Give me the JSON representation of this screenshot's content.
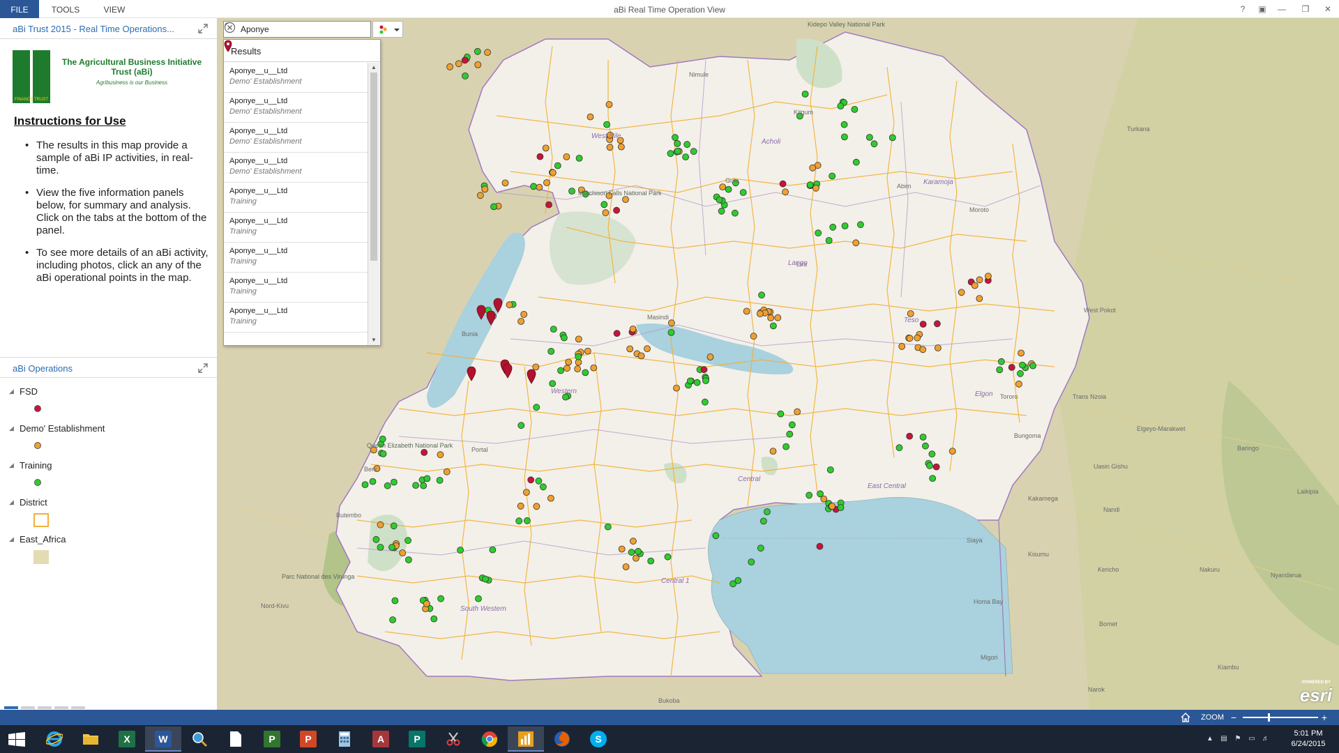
{
  "app": {
    "title": "aBi Real Time Operation View",
    "menu": {
      "file": "FILE",
      "tools": "TOOLS",
      "view": "VIEW"
    },
    "window_controls": [
      "?",
      "▣",
      "—",
      "❐",
      "✕"
    ]
  },
  "left_panel": {
    "title": "aBi Trust 2015 - Real Time Operations...",
    "logo": {
      "name": "The Agricultural Business Initiative Trust (aBi)",
      "tagline": "Agribusiness is our Business",
      "mark_left": "FINANCE",
      "mark_right": "TRUST"
    },
    "instructions_heading": "Instructions for Use",
    "instructions": [
      "The results in this map provide a sample of aBi IP activities, in real-time.",
      "View the five information panels below, for summary and analysis. Click on the tabs at the bottom of the panel.",
      "To see more details of an aBi activity, including photos, click an any of the aBi operational points in the map."
    ]
  },
  "legend": {
    "title": "aBi Operations",
    "groups": [
      {
        "label": "FSD",
        "color": "#c8143c"
      },
      {
        "label": "Demo' Establishment",
        "color": "#f0a030"
      },
      {
        "label": "Training",
        "color": "#2ecc2e"
      },
      {
        "label": "District",
        "color": "#f2b036"
      },
      {
        "label": "East_Africa",
        "color": "#e3dcb2"
      }
    ]
  },
  "search": {
    "value": "Aponye",
    "results_title": "Results",
    "results": [
      {
        "name": "Aponye__u__Ltd",
        "type": "Demo' Establishment"
      },
      {
        "name": "Aponye__u__Ltd",
        "type": "Demo' Establishment"
      },
      {
        "name": "Aponye__u__Ltd",
        "type": "Demo' Establishment"
      },
      {
        "name": "Aponye__u__Ltd",
        "type": "Demo' Establishment"
      },
      {
        "name": "Aponye__u__Ltd",
        "type": "Training"
      },
      {
        "name": "Aponye__u__Ltd",
        "type": "Training"
      },
      {
        "name": "Aponye__u__Ltd",
        "type": "Training"
      },
      {
        "name": "Aponye__u__Ltd",
        "type": "Training"
      },
      {
        "name": "Aponye__u__Ltd",
        "type": "Training"
      }
    ]
  },
  "map": {
    "places": {
      "kidepo": "Kidepo Valley National Park",
      "murchison": "Murchison Falls National Park",
      "queen_elizabeth": "Queen Elizabeth National Park",
      "virunga": "Parc National des Virunga",
      "turkana": "Turkana",
      "west_pokot": "West Pokot",
      "trans_nzoia": "Trans Nzoia",
      "bungoma": "Bungoma",
      "elgeyo": "Elgeyo-Marakwet",
      "baringo": "Baringo",
      "uasin_gishu": "Uasin Gishu",
      "kakamega": "Kakamega",
      "laikipia": "Laikipia",
      "nandi": "Nandi",
      "siaya": "Siaya",
      "kisumu": "Kisumu",
      "kericho": "Kericho",
      "nakuru": "Nakuru",
      "nyandarua": "Nyandarua",
      "homa_bay": "Homa Bay",
      "bomet": "Bomet",
      "migori": "Migori",
      "narok": "Narok",
      "kiambu": "Kiambu",
      "bukoba": "Bukoba",
      "butembo": "Butembo",
      "beni": "Beni",
      "bunia": "Bunia",
      "nord_kivu": "Nord-Kivu",
      "kitgum": "Kitgum",
      "abim": "Abim",
      "moroto": "Moroto",
      "nimule": "Nimule",
      "gulu": "Gulu",
      "lira": "Lira",
      "masindi": "Masindi",
      "fort_portal": "Portal",
      "tororo": "Tororo"
    },
    "regions": {
      "west_nile": "West Nile",
      "acholi": "Acholi",
      "karamoja": "Karamoja",
      "lango": "Lango",
      "teso": "Teso",
      "elgon": "Elgon",
      "western": "Western",
      "central": "Central",
      "east_central": "East Central",
      "central_1": "Central 1",
      "south_western": "South Western"
    },
    "esri": {
      "powered": "POWERED BY",
      "brand": "esri"
    }
  },
  "zoom_bar": {
    "label": "ZOOM",
    "out": "−",
    "in": "+",
    "level_fraction": 0.33
  },
  "taskbar": {
    "apps": [
      "start",
      "internet-explorer",
      "file-explorer",
      "excel",
      "word",
      "search-magnifier",
      "blank-document",
      "project",
      "powerpoint",
      "calculator",
      "access",
      "publisher",
      "snipping-tool",
      "chrome",
      "operations-dashboard",
      "firefox",
      "skype"
    ],
    "labels": {
      "excel": "X",
      "word": "W",
      "project": "P",
      "powerpoint": "P",
      "access": "A",
      "publisher": "P",
      "skype": "S"
    },
    "time": "5:01 PM",
    "date": "6/24/2015"
  }
}
